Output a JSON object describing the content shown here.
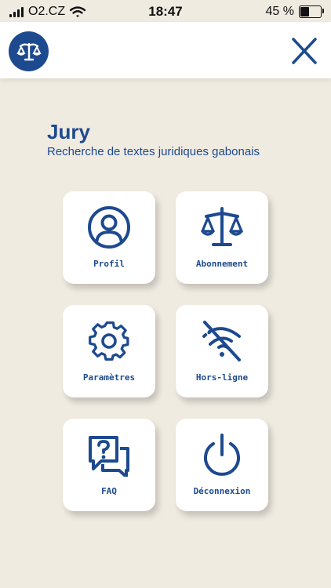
{
  "status_bar": {
    "carrier": "O2.CZ",
    "time": "18:47",
    "battery": "45 %",
    "battery_level": 0.45
  },
  "header": {
    "logo_icon": "scales-logo-icon",
    "close_icon": "close-icon"
  },
  "main": {
    "title": "Jury",
    "subtitle": "Recherche de textes juridiques gabonais"
  },
  "menu": [
    {
      "label": "Profil",
      "icon": "user-circle-icon"
    },
    {
      "label": "Abonnement",
      "icon": "scales-icon"
    },
    {
      "label": "Paramètres",
      "icon": "gear-icon"
    },
    {
      "label": "Hors-ligne",
      "icon": "wifi-off-icon"
    },
    {
      "label": "FAQ",
      "icon": "question-chat-icon"
    },
    {
      "label": "Déconnexion",
      "icon": "power-icon"
    }
  ],
  "colors": {
    "primary": "#1d4a8f",
    "background": "#f0ebe1",
    "tile": "#ffffff"
  }
}
